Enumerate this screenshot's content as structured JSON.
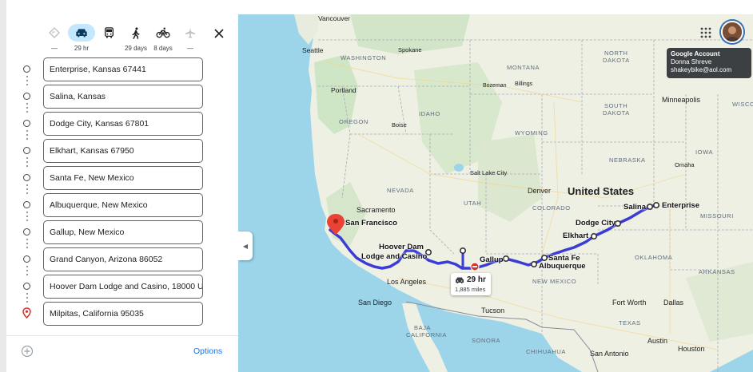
{
  "travel_modes": [
    {
      "name": "best",
      "icon": "diamond-route-icon",
      "label": "—"
    },
    {
      "name": "drive",
      "icon": "car-icon",
      "label": "29 hr"
    },
    {
      "name": "transit",
      "icon": "bus-icon",
      "label": ""
    },
    {
      "name": "walk",
      "icon": "walking-icon",
      "label": "29 days"
    },
    {
      "name": "bike",
      "icon": "bicycle-icon",
      "label": "8 days"
    },
    {
      "name": "flight",
      "icon": "airplane-icon",
      "label": "—"
    }
  ],
  "stops": [
    "Enterprise, Kansas 67441",
    "Salina, Kansas",
    "Dodge City, Kansas 67801",
    "Elkhart, Kansas 67950",
    "Santa Fe, New Mexico",
    "Albuquerque, New Mexico",
    "Gallup, New Mexico",
    "Grand Canyon, Arizona 86052",
    "Hoover Dam Lodge and Casino, 18000 U",
    "Milpitas, California 95035"
  ],
  "options_label": "Options",
  "account": {
    "title": "Google Account",
    "name": "Donna Shreve",
    "email": "shakeybike@aol.com"
  },
  "route_summary": {
    "time": "29 hr",
    "distance": "1,885 miles"
  },
  "map_labels": {
    "vancouver": "Vancouver",
    "seattle": "Seattle",
    "spokane": "Spokane",
    "washington": "WASHINGTON",
    "portland": "Portland",
    "bozeman": "Bozeman",
    "billings": "Billings",
    "montana": "MONTANA",
    "north_dakota_1": "NORTH",
    "north_dakota_2": "DAKOTA",
    "oregon": "OREGON",
    "idaho": "IDAHO",
    "boise": "Boise",
    "south_dakota_1": "SOUTH",
    "south_dakota_2": "DAKOTA",
    "minneapolis": "Minneapolis",
    "wisconsin": "WISCO",
    "wyoming": "WYOMING",
    "nebraska": "NEBRASKA",
    "omaha": "Omaha",
    "iowa": "IOWA",
    "salt_lake_city": "Salt Lake City",
    "nevada": "NEVADA",
    "utah": "UTAH",
    "denver": "Denver",
    "united_states": "United States",
    "sacramento": "Sacramento",
    "san_francisco": "San Francisco",
    "colorado": "COLORADO",
    "salina": "Salina",
    "enterprise": "Enterprise",
    "missouri": "MISSOURI",
    "dodge_city": "Dodge City",
    "elkhart": "Elkhart",
    "hoover_dam_1": "Hoover Dam",
    "hoover_dam_2": "Lodge and Casino",
    "gallup": "Gallup",
    "santa_fe": "Santa Fe",
    "albuquerque": "Albuquerque",
    "oklahoma": "OKLAHOMA",
    "los_angeles": "Los Angeles",
    "new_mexico": "NEW MEXICO",
    "arkansas": "ARKANSAS",
    "san_diego": "San Diego",
    "tucson": "Tucson",
    "fort_worth": "Fort Worth",
    "dallas": "Dallas",
    "texas": "TEXAS",
    "baja_1": "BAJA",
    "baja_2": "CALIFORNIA",
    "sonora": "SONORA",
    "chihuahua": "CHIHUAHUA",
    "austin": "Austin",
    "houston": "Houston",
    "san_antonio": "San Antonio"
  },
  "colors": {
    "route": "#3b3bd6",
    "water": "#9cd4ea",
    "land": "#eef0e4",
    "active_mode": "#c2e7ff",
    "accent": "#1a73e8"
  }
}
